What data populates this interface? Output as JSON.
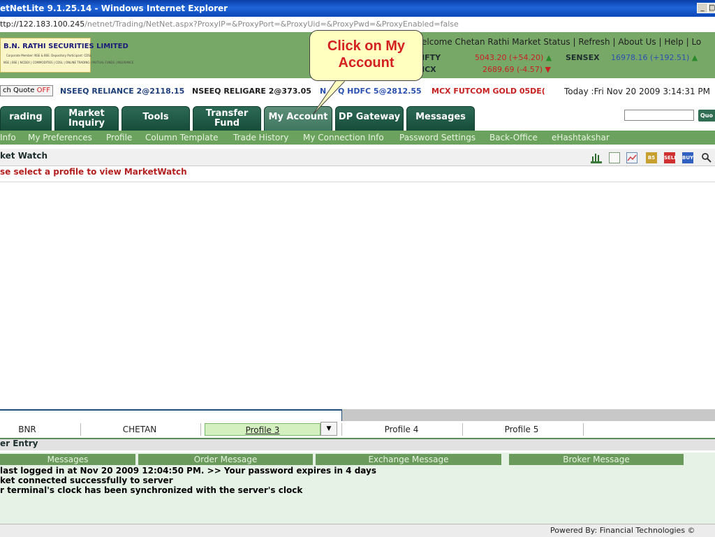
{
  "window": {
    "title": "etNetLite 9.1.25.14 - Windows Internet Explorer",
    "minimize_glyph": "_",
    "restore_glyph": "□"
  },
  "address": {
    "host": "ttp://122.183.100.245",
    "path": "/netnet/Trading/NetNet.aspx?ProxyIP=&ProxyPort=&ProxyUid=&ProxyPwd=&ProxyEnabled=false"
  },
  "logo": {
    "name": "B.N. RATHI SECURITIES LIMITED",
    "line2": "Corporate Member: NSE & BSE. Depository Participant: CDSL",
    "line3": "NSE | BSE | NCDEX | COMMODITIES | CDSL | ONLINE TRADING | MUTUAL FUNDS | INSURANCE"
  },
  "header": {
    "welcome": "elcome Chetan Rathi",
    "links": [
      "Market Status",
      "Refresh",
      "About Us",
      "Help",
      "Lo"
    ],
    "separator": "|",
    "indices": [
      {
        "name": "IFTY",
        "value": "5043.20 (+54.20)",
        "arrow": "▲",
        "color": "#c82020"
      },
      {
        "name": "SENSEX",
        "value": "16978.16 (+192.51)",
        "arrow": "▲",
        "color": "#2a50b0"
      },
      {
        "name": "ICX",
        "value": "2689.69 (-4.57)",
        "arrow": "▼",
        "color": "#c82020"
      }
    ]
  },
  "ticker": {
    "switch_label": "ch Quote",
    "switch_state": "OFF",
    "items": [
      "NSEEQ RELIANCE 2@2118.15",
      "NSEEQ RELIGARE 2@373.05",
      "N",
      "Q HDFC 5@2812.55",
      "MCX FUTCOM GOLD 05DE("
    ],
    "today": "Today :Fri Nov 20 2009 3:14:31 PM"
  },
  "tabs": [
    "rading",
    "Market\nInquiry",
    "Tools",
    "Transfer\nFund",
    "My Account",
    "DP Gateway",
    "Messages"
  ],
  "quote": {
    "label": "Quo"
  },
  "submenu": [
    "Info",
    "My Preferences",
    "Profile",
    "Column Template",
    "Trade History",
    "My Connection Info",
    "Password Settings",
    "Back-Office",
    "eHashtakshar"
  ],
  "market_watch": {
    "title": "ket Watch",
    "message": "se select a profile to view MarketWatch",
    "icons": [
      {
        "name": "bar-chart-icon",
        "text": "",
        "color": "#3a7a3a"
      },
      {
        "name": "document-icon",
        "text": "",
        "color": "#7a9a7a"
      },
      {
        "name": "line-chart-icon",
        "text": "",
        "color": "#6a8ab0"
      },
      {
        "name": "b5-icon",
        "text": "B5",
        "color": "#c8a030"
      },
      {
        "name": "sell-icon",
        "text": "SELL",
        "color": "#d03030"
      },
      {
        "name": "buy-icon",
        "text": "BUY",
        "color": "#3060c0"
      },
      {
        "name": "magnifier-icon",
        "text": "🔍",
        "color": "#ffffff"
      }
    ]
  },
  "profiles": [
    "BNR",
    "CHETAN",
    "Profile 3",
    "Profile 4",
    "Profile 5"
  ],
  "profile_dropdown_glyph": "▼",
  "order_entry": {
    "title": "er Entry"
  },
  "message_tabs": [
    "Messages",
    "Order Message",
    "Exchange Message",
    "Broker Message"
  ],
  "messages": [
    " last logged in at Nov 20 2009 12:04:50 PM. >> Your password expires in 4 days",
    "ket connected successfully to server",
    "r terminal's clock has been synchronized with the server's clock"
  ],
  "footer": {
    "powered_by": "Powered By: Financial Technologies ©"
  },
  "callout": {
    "text": "Click on  My Account"
  }
}
